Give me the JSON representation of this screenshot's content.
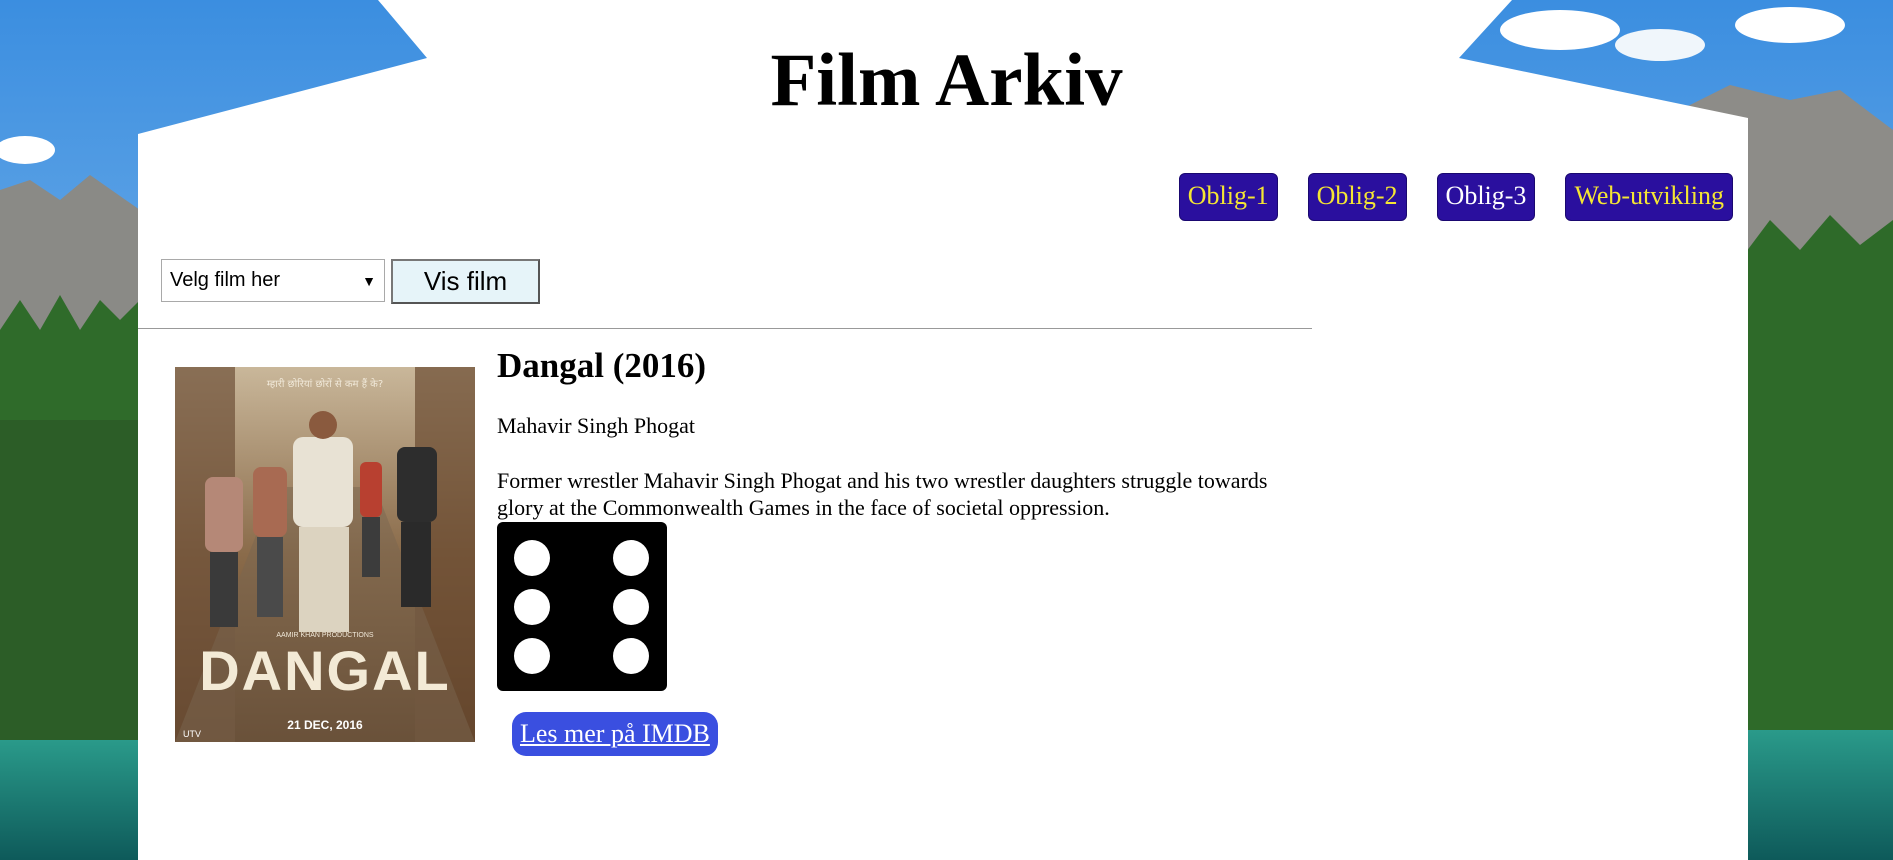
{
  "header": {
    "title": "Film Arkiv"
  },
  "nav": {
    "items": [
      {
        "label": "Oblig-1"
      },
      {
        "label": "Oblig-2"
      },
      {
        "label": "Oblig-3"
      },
      {
        "label": "Web-utvikling"
      }
    ]
  },
  "controls": {
    "select_value": "Velg film her",
    "submit_label": "Vis film"
  },
  "film": {
    "title": "Dangal (2016)",
    "director": "Mahavir Singh Phogat",
    "plot": "Former wrestler Mahavir Singh Phogat and his two wrestler daughters struggle towards glory at the Commonwealth Games in the face of societal oppression.",
    "rating_dice": 6,
    "imdb_link": "Les mer på IMDB",
    "poster": {
      "tagline": "म्हारी छोरियां छोरों से कम हैं के?",
      "producer": "AAMIR KHAN PRODUCTIONS",
      "name": "DANGAL",
      "date": "21 DEC, 2016",
      "studio": "UTV"
    }
  },
  "colors": {
    "nav_bg": "#2a0f9e",
    "nav_text": "#f5e633",
    "imdb_bg": "#3a4fe0",
    "button_bg": "#e6f4f9"
  }
}
